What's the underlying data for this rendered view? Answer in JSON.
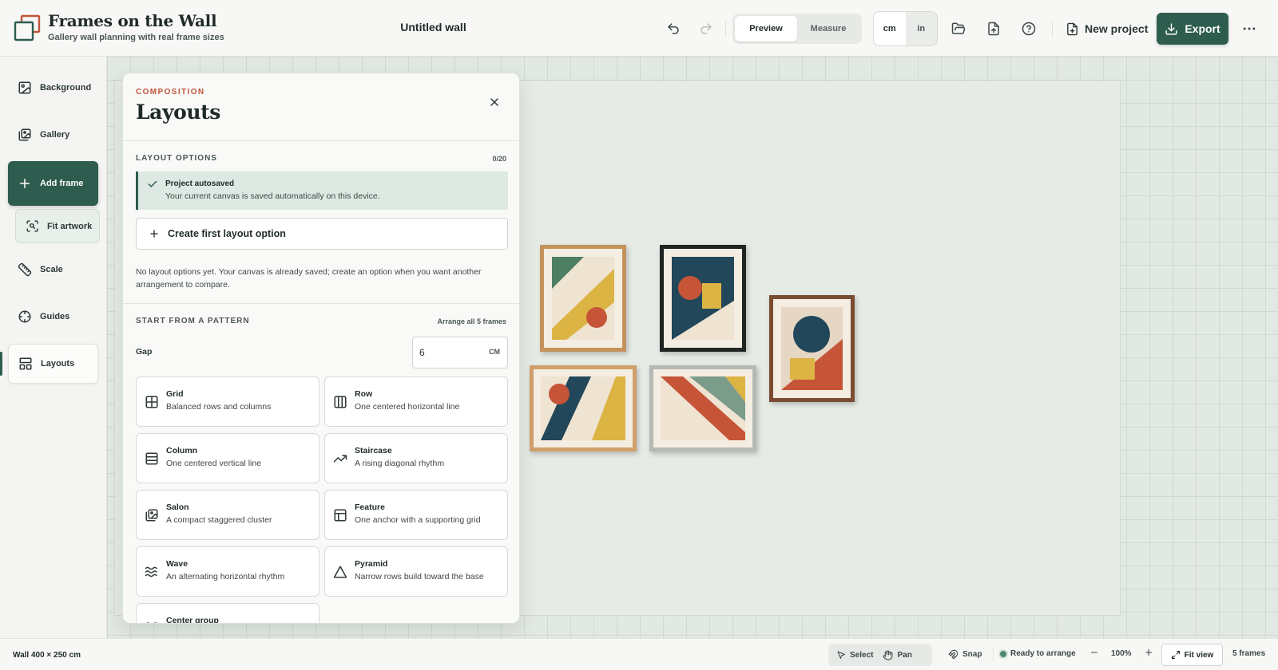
{
  "header": {
    "brand_title": "Frames on the Wall",
    "brand_subtitle": "Gallery wall planning with real frame sizes",
    "document_title": "Untitled wall",
    "mode_options": [
      "Preview",
      "Measure"
    ],
    "active_mode": "Preview",
    "unit_options": [
      "cm",
      "in"
    ],
    "active_unit": "cm",
    "new_project_label": "New project",
    "export_label": "Export",
    "colors": {
      "brand": "#2e5d4f",
      "logo_accent": "#c2533b"
    }
  },
  "sidebar": {
    "items": [
      {
        "label": "Background",
        "icon": "image-icon"
      },
      {
        "label": "Gallery",
        "icon": "gallery-icon"
      },
      {
        "label": "Add frame",
        "icon": "plus-icon"
      },
      {
        "label": "Fit artwork",
        "icon": "fit-artwork-icon"
      },
      {
        "label": "Scale",
        "icon": "ruler-icon"
      },
      {
        "label": "Guides",
        "icon": "crosshair-icon"
      },
      {
        "label": "Layouts",
        "icon": "layout-icon"
      }
    ],
    "active_item": "Layouts"
  },
  "panel": {
    "eyebrow": "COMPOSITION",
    "title": "Layouts",
    "layout_options_label": "LAYOUT OPTIONS",
    "layout_options_count": "0/20",
    "notice_title": "Project autosaved",
    "notice_text": "Your current canvas is saved automatically on this device.",
    "create_label": "Create first layout option",
    "empty_text": "No layout options yet. Your canvas is already saved; create an option when you want another arrangement to compare.",
    "pattern_label": "START FROM A PATTERN",
    "arrange_label": "Arrange all 5 frames",
    "gap_label": "Gap",
    "gap_value": "6",
    "gap_unit": "CM",
    "patterns": [
      {
        "title": "Grid",
        "desc": "Balanced rows and columns",
        "icon": "grid-icon"
      },
      {
        "title": "Row",
        "desc": "One centered horizontal line",
        "icon": "row-icon"
      },
      {
        "title": "Column",
        "desc": "One centered vertical line",
        "icon": "column-icon"
      },
      {
        "title": "Staircase",
        "desc": "A rising diagonal rhythm",
        "icon": "staircase-icon"
      },
      {
        "title": "Salon",
        "desc": "A compact staggered cluster",
        "icon": "salon-icon"
      },
      {
        "title": "Feature",
        "desc": "One anchor with a supporting grid",
        "icon": "feature-icon"
      },
      {
        "title": "Wave",
        "desc": "An alternating horizontal rhythm",
        "icon": "wave-icon"
      },
      {
        "title": "Pyramid",
        "desc": "Narrow rows build toward the base",
        "icon": "pyramid-icon"
      },
      {
        "title": "Center group",
        "desc": "",
        "icon": "center-group-icon"
      }
    ]
  },
  "statusbar": {
    "wall_size": "Wall 400 × 250 cm",
    "select_label": "Select",
    "pan_label": "Pan",
    "snap_label": "Snap",
    "status_label": "Ready to arrange",
    "zoom_label": "100%",
    "fit_view_label": "Fit view",
    "frame_count_label": "5 frames"
  }
}
